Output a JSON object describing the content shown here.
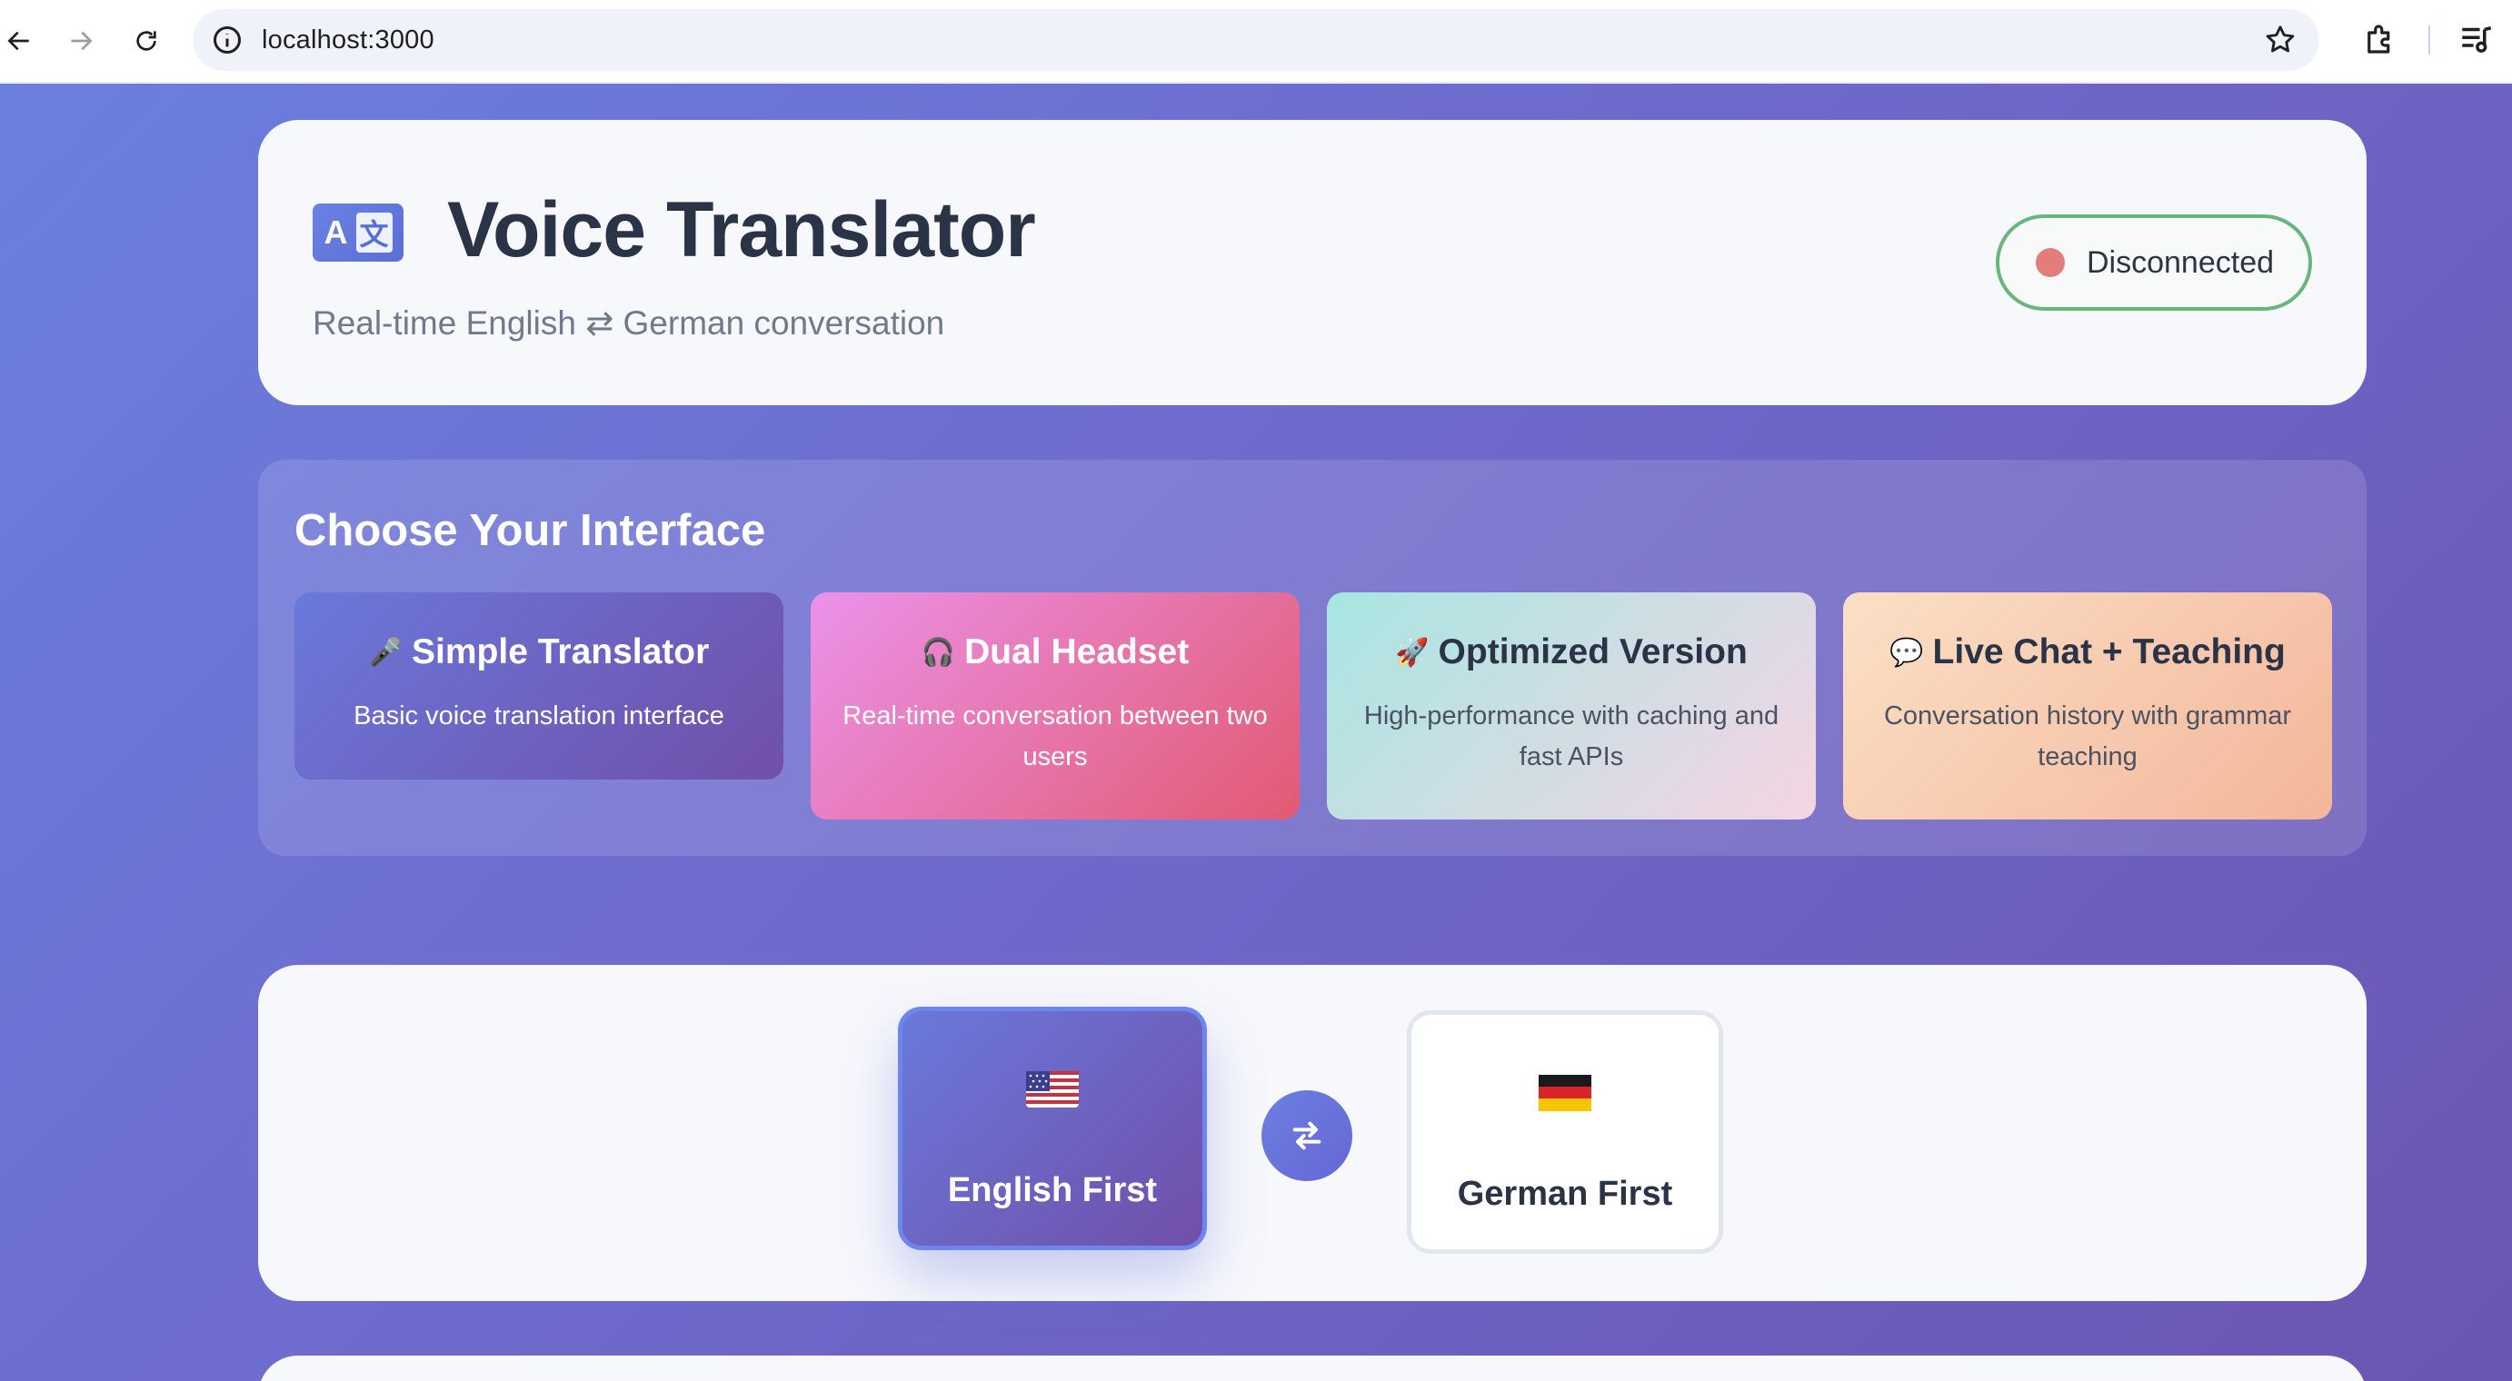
{
  "browser": {
    "url": "localhost:3000"
  },
  "header": {
    "title": "Voice Translator",
    "subtitle": "Real-time English ⇄ German conversation",
    "status_label": "Disconnected",
    "status_color": "#e57c7c",
    "logo_icon": "translate-icon"
  },
  "interface_chooser": {
    "heading": "Choose Your Interface",
    "options": [
      {
        "icon": "🎤",
        "title": "Simple Translator",
        "description": "Basic voice translation interface"
      },
      {
        "icon": "🎧",
        "title": "Dual Headset",
        "description": "Real-time conversation between two users"
      },
      {
        "icon": "🚀",
        "title": "Optimized Version",
        "description": "High-performance with caching and fast APIs"
      },
      {
        "icon": "💬",
        "title": "Live Chat + Teaching",
        "description": "Conversation history with grammar teaching"
      }
    ]
  },
  "mode_select": {
    "english": {
      "flag": "us-flag",
      "label": "English First",
      "selected": true
    },
    "swap_icon": "swap-arrows-icon",
    "german": {
      "flag": "de-flag",
      "label": "German First",
      "selected": false
    }
  },
  "colors": {
    "accent": "#6a79db",
    "status_border": "#68b67c"
  }
}
